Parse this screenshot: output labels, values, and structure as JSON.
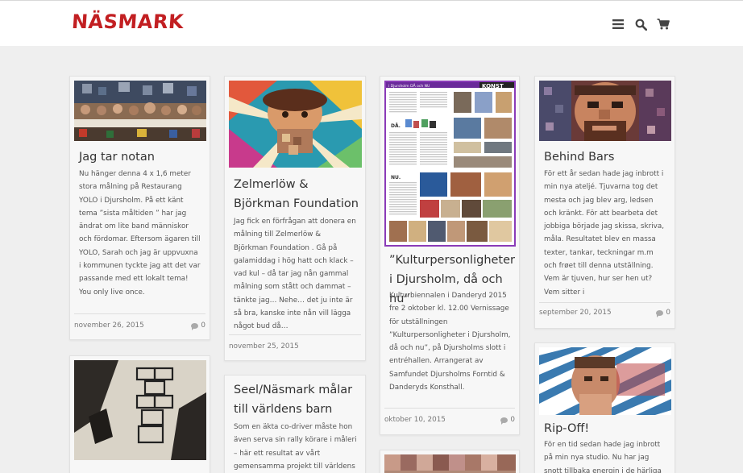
{
  "site": {
    "logo": "NÄSMARK"
  },
  "nav": {
    "icons": [
      "menu-icon",
      "search-icon",
      "cart-icon"
    ]
  },
  "posts": [
    {
      "title": "Jag tar notan",
      "excerpt": "Nu hänger denna 4 x 1,6 meter stora målning på Restaurang YOLO i Djursholm. På ett känt tema ”sista måltiden ” har jag ändrat om lite band människor och fördomar. Eftersom ägaren till YOLO, Sarah och jag är uppvuxna i kommunen tyckte jag att det var passande med ett lokalt tema! You only live once.",
      "date": "november 26, 2015",
      "comments": "0"
    },
    {
      "title": "Zelmerlöw & Björkman Foundation",
      "excerpt": "Jag fick en förfrågan att donera en målning till Zelmerlöw & Björkman Foundation . Gå på galamiddag i hög hatt och klack – vad kul – då tar jag nån gammal målning som stått och dammat – tänkte jag… Nehe… det ju inte är så bra, kanske inte nån vill lägga något bud då…",
      "date": "november 25, 2015",
      "comments": ""
    },
    {
      "title": "”Kulturpersonligheter i Djursholm, då och nu”",
      "excerpt": "Kulturbiennalen i Danderyd 2015 fre 2 oktober kl. 12.00 Vernissage för utställningen ”Kulturpersonligheter i Djursholm, då och nu”, på Djursholms slott i entréhallen. Arrangerat av Samfundet Djursholms Forntid & Danderyds Konsthall.",
      "date": "oktober 10, 2015",
      "comments": "0",
      "poster_title": "i Djursholm DÅ och NU",
      "poster_heading": "KONST",
      "poster_da": "DÅ.",
      "poster_nu": "NU."
    },
    {
      "title": "Behind Bars",
      "excerpt": "För ett år sedan hade jag inbrott i min nya ateljé. Tjuvarna tog det mesta och jag blev arg, ledsen och kränkt. För att bearbeta det jobbiga började jag skissa, skriva, måla. Resultatet blev en massa texter, tankar, teckningar m.m och frøet till denna utställning. Vem är tjuven, hur ser hen ut? Vem sitter i",
      "date": "september 20, 2015",
      "comments": "0"
    },
    {
      "title": "Seel/Näsmark målar till världens barn",
      "excerpt": "Som en äkta co-driver måste hon även serva sin rally körare i måleri – här ett resultat av vårt gemensamma projekt till världens",
      "date": "",
      "comments": ""
    },
    {
      "title": "Rip-Off!",
      "excerpt": "För en tid sedan hade jag inbrott på min nya studio. Nu har jag snott tillbaka energin i de härliga",
      "date": "",
      "comments": ""
    }
  ]
}
